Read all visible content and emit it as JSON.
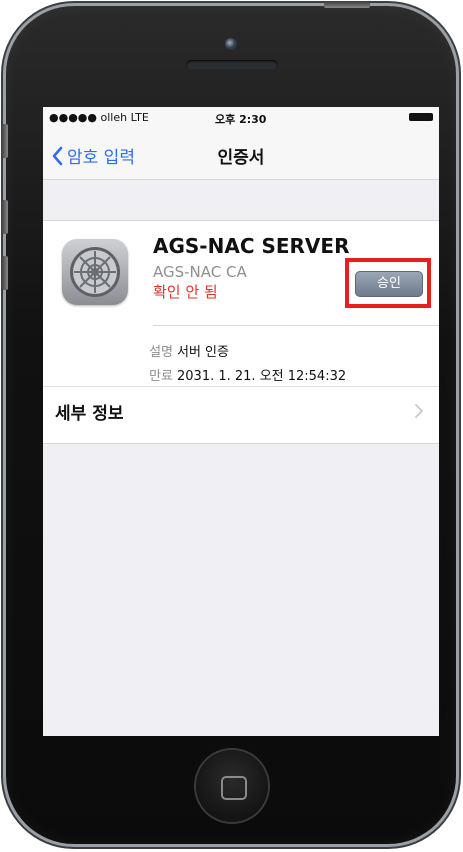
{
  "status_bar": {
    "carrier": "●●●●● olleh  LTE",
    "time": "오후 2:30"
  },
  "nav": {
    "back_label": "암호 입력",
    "title": "인증서"
  },
  "certificate": {
    "title": "AGS-NAC SERVER",
    "issuer": "AGS-NAC CA",
    "status": "확인 안 됨",
    "approve_label": "승인",
    "details": [
      {
        "label": "설명",
        "value": "서버 인증"
      },
      {
        "label": "만료",
        "value": "2031. 1. 21. 오전 12:54:32"
      }
    ],
    "more_label": "세부 정보"
  },
  "colors": {
    "link": "#2d6ef0",
    "warning": "#e0352a",
    "highlight_box": "#e8201c"
  }
}
